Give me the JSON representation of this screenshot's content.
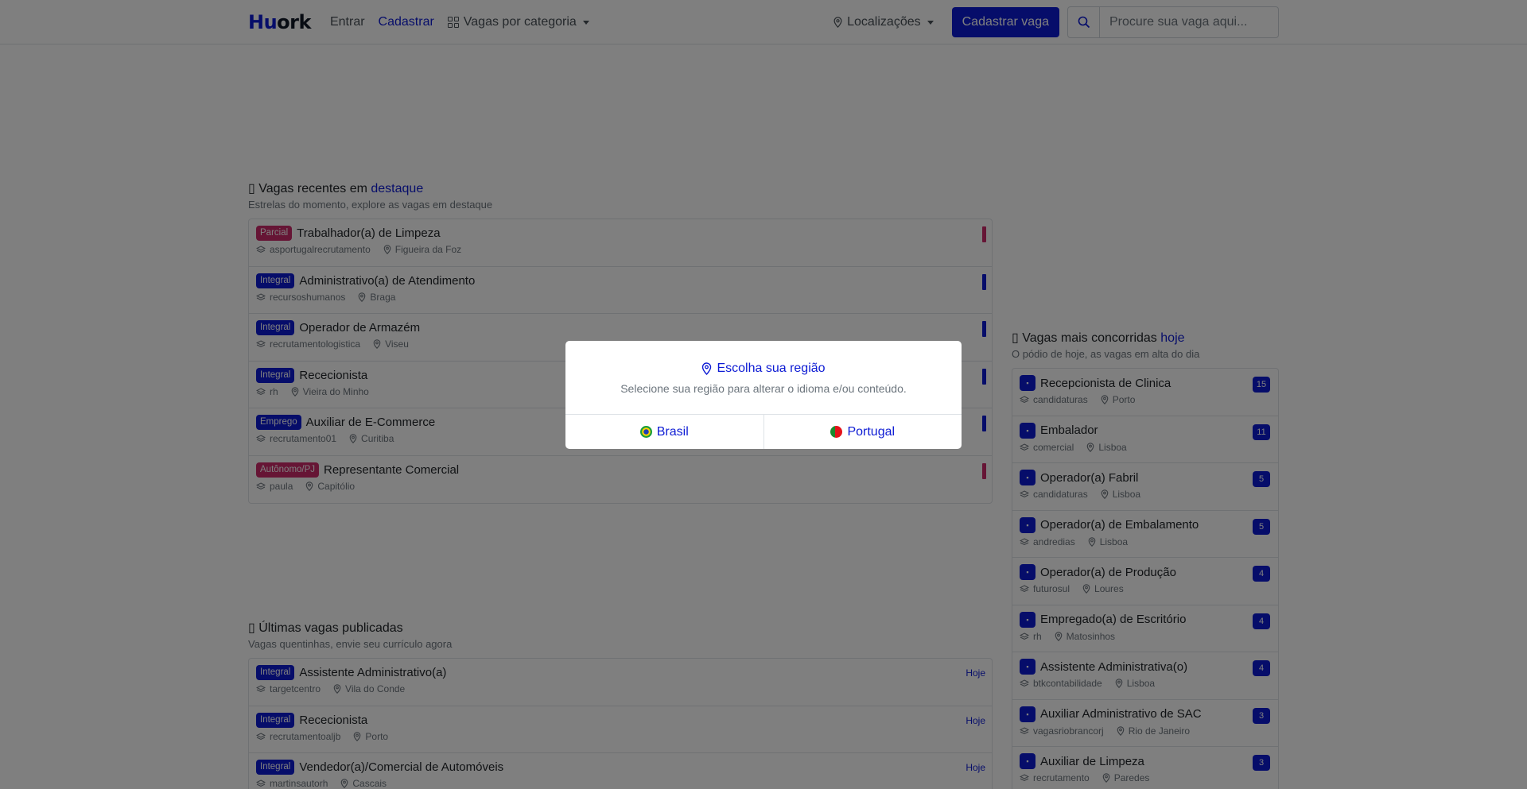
{
  "nav": {
    "brand_part1": "Hu",
    "brand_part2": "ork",
    "login": "Entrar",
    "register": "Cadastrar",
    "categories": "Vagas por categoria",
    "locations": "Localizações",
    "post_job": "Cadastrar vaga",
    "search_placeholder": "Procure sua vaga aqui..."
  },
  "featured": {
    "title_prefix": "Vagas recentes em",
    "title_highlight": "destaque",
    "subtitle": "Estrelas do momento, explore as vagas em destaque",
    "items": [
      {
        "badge": "Parcial",
        "badge_color": "#cc2b6a",
        "title": "Trabalhador(a) de Limpeza",
        "company": "asportugalrecrutamento",
        "location": "Figueira da Foz",
        "marker_color": "#cc2b6a"
      },
      {
        "badge": "Integral",
        "badge_color": "#0d1bd4",
        "title": "Administrativo(a) de Atendimento",
        "company": "recursoshumanos",
        "location": "Braga",
        "marker_color": "#0d1bd4"
      },
      {
        "badge": "Integral",
        "badge_color": "#0d1bd4",
        "title": "Operador de Armazém",
        "company": "recrutamentologistica",
        "location": "Viseu",
        "marker_color": "#0d1bd4"
      },
      {
        "badge": "Integral",
        "badge_color": "#0d1bd4",
        "title": "Rececionista",
        "company": "rh",
        "location": "Vieira do Minho",
        "marker_color": "#0d1bd4"
      },
      {
        "badge": "Emprego",
        "badge_color": "#0d1bd4",
        "title": "Auxiliar de E-Commerce",
        "company": "recrutamento01",
        "location": "Curitiba",
        "marker_color": "#0d1bd4"
      },
      {
        "badge": "Autônomo/PJ",
        "badge_color": "#cc2b6a",
        "title": "Representante Comercial",
        "company": "paula",
        "location": "Capitólio",
        "marker_color": "#cc2b6a"
      }
    ]
  },
  "latest": {
    "title": "Últimas vagas publicadas",
    "subtitle": "Vagas quentinhas, envie seu currículo agora",
    "items": [
      {
        "badge": "Integral",
        "title": "Assistente Administrativo(a)",
        "company": "targetcentro",
        "location": "Vila do Conde",
        "date": "Hoje"
      },
      {
        "badge": "Integral",
        "title": "Rececionista",
        "company": "recrutamentoaljb",
        "location": "Porto",
        "date": "Hoje"
      },
      {
        "badge": "Integral",
        "title": "Vendedor(a)/Comercial de Automóveis",
        "company": "martinsautorh",
        "location": "Cascais",
        "date": "Hoje"
      }
    ]
  },
  "popular": {
    "title_prefix": "Vagas mais concorridas",
    "title_highlight": "hoje",
    "subtitle": "O pódio de hoje, as vagas em alta do dia",
    "items": [
      {
        "title": "Recepcionista de Clinica",
        "company": "candidaturas",
        "location": "Porto",
        "count": "15"
      },
      {
        "title": "Embalador",
        "company": "comercial",
        "location": "Lisboa",
        "count": "11"
      },
      {
        "title": "Operador(a) Fabril",
        "company": "candidaturas",
        "location": "Lisboa",
        "count": "5"
      },
      {
        "title": "Operador(a) de Embalamento",
        "company": "andredias",
        "location": "Lisboa",
        "count": "5"
      },
      {
        "title": "Operador(a) de Produção",
        "company": "futurosul",
        "location": "Loures",
        "count": "4"
      },
      {
        "title": "Empregado(a) de Escritório",
        "company": "rh",
        "location": "Matosinhos",
        "count": "4"
      },
      {
        "title": "Assistente Administrativa(o)",
        "company": "btkcontabilidade",
        "location": "Lisboa",
        "count": "4"
      },
      {
        "title": "Auxiliar Administrativo de SAC",
        "company": "vagasriobrancorj",
        "location": "Rio de Janeiro",
        "count": "3"
      },
      {
        "title": "Auxiliar de Limpeza",
        "company": "recrutamento",
        "location": "Paredes",
        "count": "3"
      }
    ]
  },
  "modal": {
    "title": "Escolha sua região",
    "subtitle": "Selecione sua região para alterar o idioma e/ou conteúdo.",
    "option_brazil": "Brasil",
    "option_portugal": "Portugal"
  }
}
